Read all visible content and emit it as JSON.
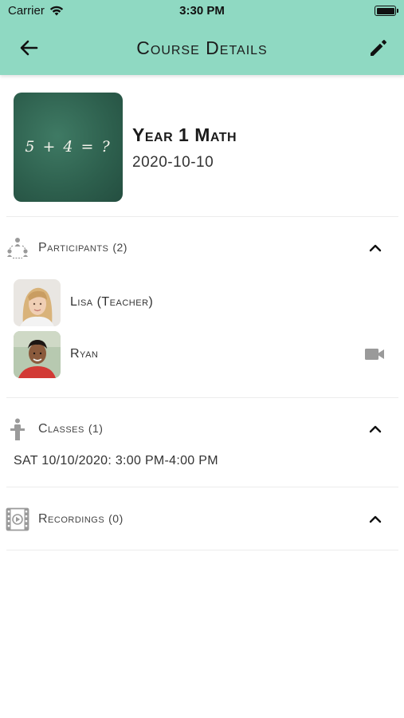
{
  "status_bar": {
    "carrier": "Carrier",
    "time": "3:30 PM"
  },
  "header": {
    "title": "Course Details",
    "back_icon": "arrow-left-icon",
    "edit_icon": "pencil-icon"
  },
  "course": {
    "thumbnail_text": "5 + 4 = ?",
    "name": "Year 1 Math",
    "date": "2020-10-10"
  },
  "participants": {
    "label": "Participants",
    "count": "(2)",
    "items": [
      {
        "name": "Lisa (Teacher)",
        "has_video": false
      },
      {
        "name": "Ryan",
        "has_video": true
      }
    ]
  },
  "classes": {
    "label": "Classes",
    "count": "(1)",
    "items": [
      {
        "text": "SAT 10/10/2020: 3:00 PM-4:00 PM"
      }
    ]
  },
  "recordings": {
    "label": "Recordings",
    "count": "(0)"
  },
  "colors": {
    "header": "#8fd9c2",
    "divider": "#ececec",
    "icon": "#9a9a9a"
  }
}
